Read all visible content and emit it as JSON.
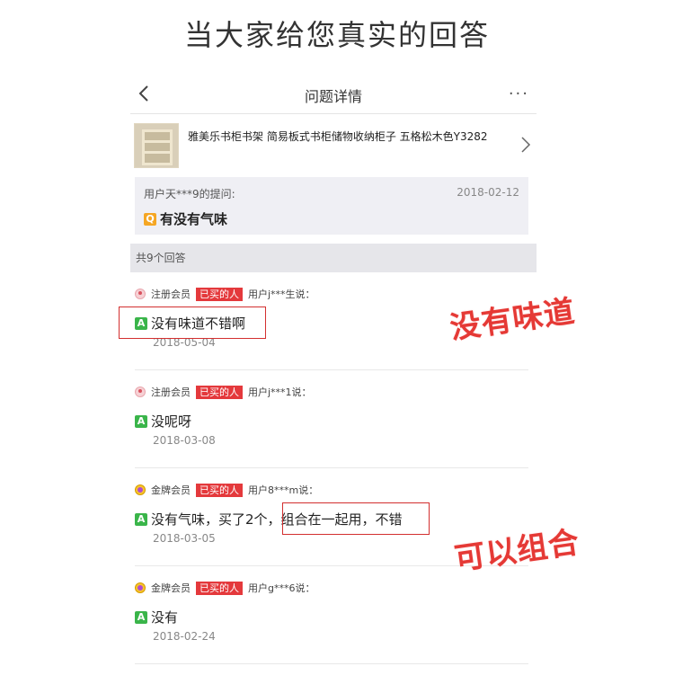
{
  "headline": "当大家给您真实的回答",
  "navbar": {
    "title": "问题详情",
    "more": "···"
  },
  "product": {
    "name": "雅美乐书柜书架 简易板式书柜储物收纳柜子 五格松木色Y3282"
  },
  "question": {
    "user": "用户天***9的提问:",
    "date": "2018-02-12",
    "badge": "Q",
    "text": "有没有气味"
  },
  "answers_count": "共9个回答",
  "answers": [
    {
      "member": "注册会员",
      "tag": "已买的人",
      "user": "用户j***生说：",
      "badge": "A",
      "text": "没有味道不错啊",
      "date": "2018-05-04"
    },
    {
      "member": "注册会员",
      "tag": "已买的人",
      "user": "用户j***1说：",
      "badge": "A",
      "text": "没呢呀",
      "date": "2018-03-08"
    },
    {
      "member": "金牌会员",
      "tag": "已买的人",
      "user": "用户8***m说：",
      "badge": "A",
      "text": "没有气味，买了2个，组合在一起用，不错",
      "date": "2018-03-05"
    },
    {
      "member": "金牌会员",
      "tag": "已买的人",
      "user": "用户g***6说：",
      "badge": "A",
      "text": "没有",
      "date": "2018-02-24"
    }
  ],
  "callouts": {
    "first": "没有味道",
    "second": "可以组合"
  },
  "colors": {
    "accent_red": "#e4393c",
    "answer_green": "#3ab54a",
    "question_orange": "#f5a623"
  }
}
